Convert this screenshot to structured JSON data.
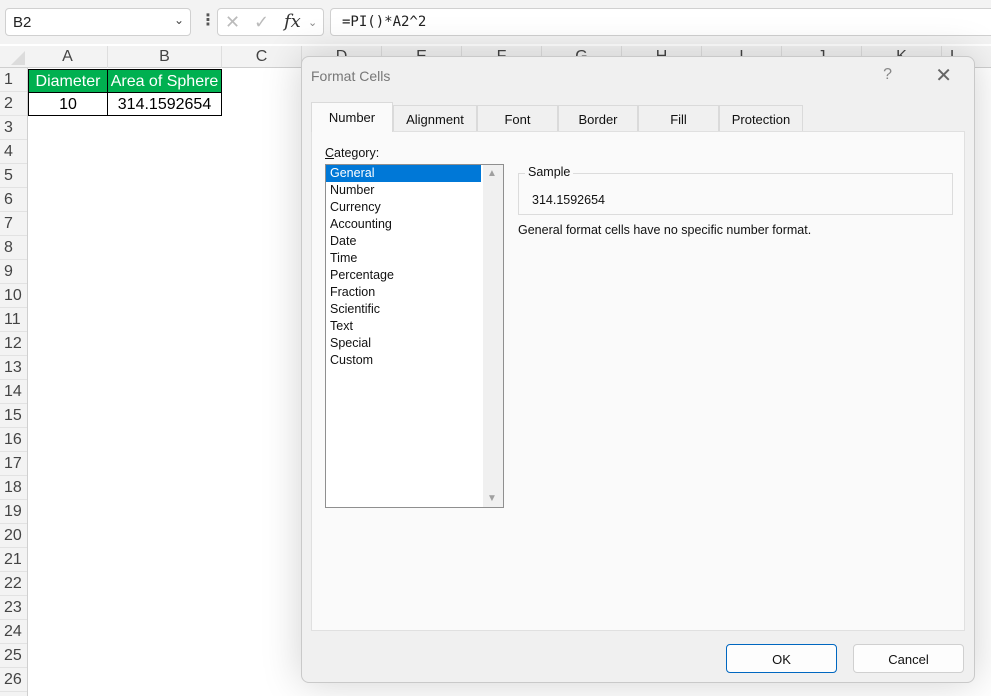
{
  "formula_bar": {
    "name_box": "B2",
    "cancel_icon": "✕",
    "enter_icon": "✓",
    "fx_label": "fx",
    "formula": "=PI()*A2^2"
  },
  "grid": {
    "columns": [
      "A",
      "B",
      "C",
      "D",
      "E",
      "F",
      "G",
      "H",
      "I",
      "J",
      "K",
      "L"
    ],
    "rows": [
      "1",
      "2",
      "3",
      "4",
      "5",
      "6",
      "7",
      "8",
      "9",
      "10",
      "11",
      "12",
      "13",
      "14",
      "15",
      "16",
      "17",
      "18",
      "19",
      "20",
      "21",
      "22",
      "23",
      "24",
      "25",
      "26"
    ],
    "cells": {
      "A1": "Diameter",
      "B1": "Area of Sphere",
      "A2": "10",
      "B2": "314.1592654"
    },
    "header_fill": "#00b050"
  },
  "dialog": {
    "title": "Format Cells",
    "help": "?",
    "close": "✕",
    "tabs": [
      {
        "label": "Number",
        "active": true
      },
      {
        "label": "Alignment",
        "active": false
      },
      {
        "label": "Font",
        "active": false
      },
      {
        "label": "Border",
        "active": false
      },
      {
        "label": "Fill",
        "active": false
      },
      {
        "label": "Protection",
        "active": false
      }
    ],
    "category_label_accel": "C",
    "category_label_rest": "ategory:",
    "categories": [
      "General",
      "Number",
      "Currency",
      "Accounting",
      "Date",
      "Time",
      "Percentage",
      "Fraction",
      "Scientific",
      "Text",
      "Special",
      "Custom"
    ],
    "selected_category": "General",
    "sample_label": "Sample",
    "sample_value": "314.1592654",
    "description": "General format cells have no specific number format.",
    "ok_label": "OK",
    "cancel_label": "Cancel",
    "accent": "#0078d7"
  }
}
